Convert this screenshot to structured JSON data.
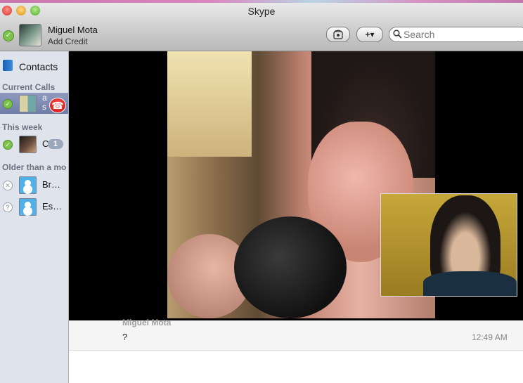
{
  "window": {
    "title": "Skype"
  },
  "toolbar": {
    "profile_name": "Miguel Mota",
    "add_credit": "Add Credit",
    "add_button_label": "+▾",
    "search_placeholder": "Search"
  },
  "sidebar": {
    "contacts_label": "Contacts",
    "sections": {
      "current_calls": "Current Calls",
      "this_week": "This week",
      "older": "Older than a mo"
    },
    "current_call": {
      "name": "a s",
      "status": "online"
    },
    "this_week_item": {
      "name": "C",
      "badge": "1",
      "status": "online"
    },
    "older_items": [
      {
        "name": "Br…",
        "status": "offline"
      },
      {
        "name": "Es…",
        "status": "offline"
      }
    ]
  },
  "chat": {
    "sender": "Miguel Mota",
    "message": "?",
    "time": "12:49 AM"
  },
  "colors": {
    "online_green": "#7cc24b",
    "hangup_red": "#d11a18",
    "active_row": "#7d8ab3",
    "sidebar_bg": "#dfe4ec"
  },
  "icons": {
    "status": "checkmark-icon",
    "phone": "phone-dial-icon",
    "hangup": "hangup-icon",
    "search": "search-icon",
    "contacts": "contacts-book-icon"
  }
}
